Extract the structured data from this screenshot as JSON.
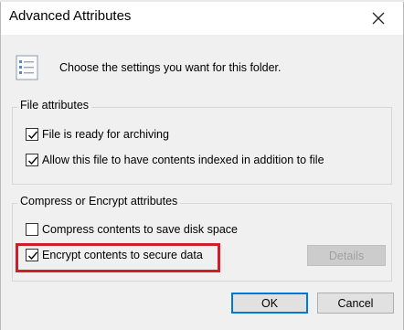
{
  "dialog": {
    "title": "Advanced Attributes",
    "close_glyph": "✕",
    "header_text": "Choose the settings you want for this folder.",
    "icon": "folder-settings-icon"
  },
  "file_attributes": {
    "label": "File attributes",
    "items": [
      {
        "label": "File is ready for archiving",
        "checked": true
      },
      {
        "label": "Allow this file to have contents indexed in addition to file",
        "checked": true
      }
    ]
  },
  "compress_encrypt": {
    "label": "Compress or Encrypt attributes",
    "items": [
      {
        "label": "Compress contents to save disk space",
        "checked": false
      },
      {
        "label": "Encrypt contents to secure data",
        "checked": true
      }
    ],
    "details_label": "Details",
    "details_enabled": false
  },
  "buttons": {
    "ok": "OK",
    "cancel": "Cancel"
  },
  "colors": {
    "highlight": "#d11d2b",
    "default_button_border": "#0078d7"
  }
}
